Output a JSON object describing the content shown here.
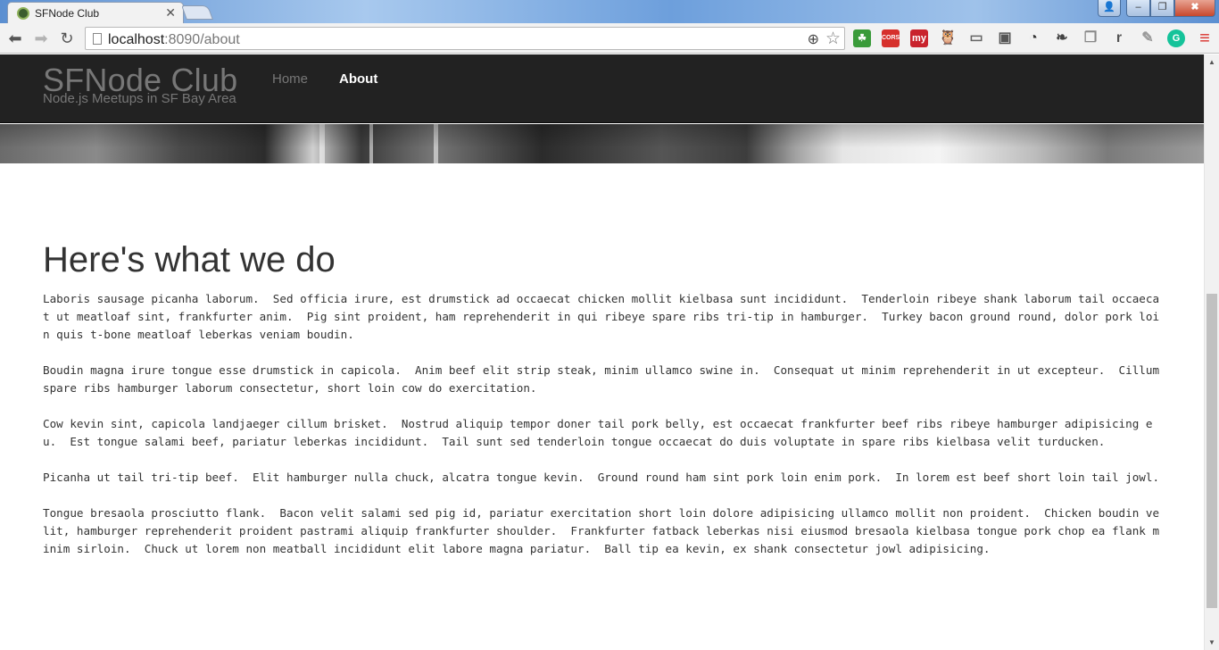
{
  "browser": {
    "tab_title": "SFNode Club",
    "url_host": "localhost",
    "url_rest": ":8090/about",
    "window_controls": {
      "user": "👤",
      "minimize": "–",
      "maximize": "❐",
      "close": "✖"
    },
    "extensions": [
      {
        "icon": "green-leaf-icon",
        "label": "☘",
        "color": "#3a9b3a"
      },
      {
        "icon": "cors-icon",
        "label": "CORS",
        "color": "#d6302b"
      },
      {
        "icon": "my-icon",
        "label": "my",
        "color": "#c9232d"
      },
      {
        "icon": "owl-icon",
        "label": "🦉",
        "color": "#333333"
      },
      {
        "icon": "cast-icon",
        "label": "▭",
        "color": "#666666"
      },
      {
        "icon": "monitor-icon",
        "label": "▣",
        "color": "#555555"
      },
      {
        "icon": "compass-icon",
        "label": "◔",
        "color": "#333333"
      },
      {
        "icon": "evernote-icon",
        "label": "❧",
        "color": "#444444"
      },
      {
        "icon": "copy-icon",
        "label": "❐",
        "color": "#888888"
      },
      {
        "icon": "r-icon",
        "label": "r",
        "color": "#555555"
      },
      {
        "icon": "notepad-icon",
        "label": "✎",
        "color": "#999999"
      },
      {
        "icon": "grammarly-icon",
        "label": "G",
        "color": "#15c39a"
      },
      {
        "icon": "menu-icon",
        "label": "≡",
        "color": "#d9302b"
      }
    ]
  },
  "navbar": {
    "brand": "SFNode Club",
    "tagline": "Node.js Meetups in SF Bay Area",
    "links": [
      "Home",
      "About"
    ]
  },
  "main": {
    "heading": "Here's what we do",
    "paragraphs": [
      "Laboris sausage picanha laborum.  Sed officia irure, est drumstick ad occaecat chicken mollit kielbasa sunt incididunt.  Tenderloin ribeye shank laborum tail occaecat ut meatloaf sint, frankfurter anim.  Pig sint proident, ham reprehenderit in qui ribeye spare ribs tri-tip in hamburger.  Turkey bacon ground round, dolor pork loin quis t-bone meatloaf leberkas veniam boudin.",
      "Boudin magna irure tongue esse drumstick in capicola.  Anim beef elit strip steak, minim ullamco swine in.  Consequat ut minim reprehenderit in ut excepteur.  Cillum spare ribs hamburger laborum consectetur, short loin cow do exercitation.",
      "Cow kevin sint, capicola landjaeger cillum brisket.  Nostrud aliquip tempor doner tail pork belly, est occaecat frankfurter beef ribs ribeye hamburger adipisicing eu.  Est tongue salami beef, pariatur leberkas incididunt.  Tail sunt sed tenderloin tongue occaecat do duis voluptate in spare ribs kielbasa velit turducken.",
      "Picanha ut tail tri-tip beef.  Elit hamburger nulla chuck, alcatra tongue kevin.  Ground round ham sint pork loin enim pork.  In lorem est beef short loin tail jowl.",
      "Tongue bresaola prosciutto flank.  Bacon velit salami sed pig id, pariatur exercitation short loin dolore adipisicing ullamco mollit non proident.  Chicken boudin velit, hamburger reprehenderit proident pastrami aliquip frankfurter shoulder.  Frankfurter fatback leberkas nisi eiusmod bresaola kielbasa tongue pork chop ea flank minim sirloin.  Chuck ut lorem non meatball incididunt elit labore magna pariatur.  Ball tip ea kevin, ex shank consectetur jowl adipisicing."
    ]
  }
}
